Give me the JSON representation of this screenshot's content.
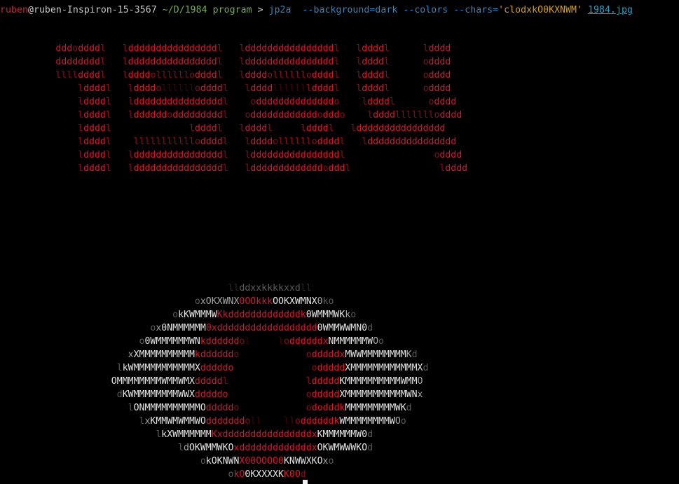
{
  "terminal": {
    "prompt": {
      "user": "ruben",
      "at": "@",
      "host": "ruben-Inspiron-15-3567",
      "path": "~/D/1984 program",
      "symbol": ">",
      "command": "jp2a",
      "options": "--background=dark --colors --chars=",
      "chars_arg": "'clodxkO0KXNWM'",
      "file": "1984.jpg"
    },
    "colors": {
      "background": "#000000",
      "user": "#d2213a",
      "path": "#6fb04c",
      "command": "#2b87c8",
      "string": "#d4a022",
      "file": "#2aa0c8",
      "art_red": "#e0132b",
      "art_white": "#e4e4e4"
    },
    "art_1984": [
      [
        [
          "          ",
          ""
        ],
        [
          "ddd",
          "r"
        ],
        [
          "o",
          "rd"
        ],
        [
          "dddd",
          "r"
        ],
        [
          "l",
          "rd"
        ],
        [
          "   ",
          ""
        ],
        [
          "l",
          "rd"
        ],
        [
          "dddddddddddddddd",
          "r"
        ],
        [
          "l",
          "rd"
        ],
        [
          "   ",
          ""
        ],
        [
          "l",
          "rd"
        ],
        [
          "dddddddddddddddd",
          "r"
        ],
        [
          "l",
          "rd"
        ],
        [
          "   ",
          ""
        ],
        [
          "l",
          "rd"
        ],
        [
          "dddd",
          "r"
        ],
        [
          "l",
          "rd"
        ],
        [
          "      ",
          ""
        ],
        [
          "l",
          "rd"
        ],
        [
          "dddd",
          "r"
        ]
      ],
      [
        [
          "          ",
          ""
        ],
        [
          "dddddddd",
          "r"
        ],
        [
          "l",
          "rd"
        ],
        [
          "   ",
          ""
        ],
        [
          "l",
          "rd"
        ],
        [
          "dddddddddddddddd",
          "r"
        ],
        [
          "l",
          "rd"
        ],
        [
          "   ",
          ""
        ],
        [
          "l",
          "rd"
        ],
        [
          "dddddddddddddddd",
          "r"
        ],
        [
          "l",
          "rd"
        ],
        [
          "   ",
          ""
        ],
        [
          "l",
          "rd"
        ],
        [
          "dddd",
          "r"
        ],
        [
          "l",
          "rd"
        ],
        [
          "      ",
          ""
        ],
        [
          "o",
          "rd"
        ],
        [
          "dddd",
          "r"
        ]
      ],
      [
        [
          "          ",
          ""
        ],
        [
          "llll",
          "rd"
        ],
        [
          "dddd",
          "r"
        ],
        [
          "l",
          "rd"
        ],
        [
          "   ",
          ""
        ],
        [
          "l",
          "rd"
        ],
        [
          "dddd",
          "r"
        ],
        [
          "ollllll",
          "rd"
        ],
        [
          "o",
          "rd"
        ],
        [
          "dddd",
          "r"
        ],
        [
          "l",
          "rd"
        ],
        [
          "   ",
          ""
        ],
        [
          "l",
          "rd"
        ],
        [
          "dddd",
          "r"
        ],
        [
          "ollllll",
          "rd"
        ],
        [
          "o",
          "rd"
        ],
        [
          "dddd",
          "r"
        ],
        [
          "l",
          "rd"
        ],
        [
          "   ",
          ""
        ],
        [
          "l",
          "rd"
        ],
        [
          "dddd",
          "r"
        ],
        [
          "l",
          "rd"
        ],
        [
          "      ",
          ""
        ],
        [
          "o",
          "rd"
        ],
        [
          "dddd",
          "r"
        ]
      ],
      [
        [
          "              ",
          ""
        ],
        [
          "l",
          "rd"
        ],
        [
          "dddd",
          "r"
        ],
        [
          "l",
          "rd"
        ],
        [
          "   ",
          ""
        ],
        [
          "l",
          "rd"
        ],
        [
          "dddd",
          "r"
        ],
        [
          "o",
          "rd"
        ],
        [
          "llllll",
          "rr"
        ],
        [
          "o",
          "rd"
        ],
        [
          "dddd",
          "r"
        ],
        [
          "l",
          "rd"
        ],
        [
          "   ",
          ""
        ],
        [
          "l",
          "rd"
        ],
        [
          "dddd",
          "r"
        ],
        [
          "llllll",
          "rr"
        ],
        [
          "l",
          "rd"
        ],
        [
          "dddd",
          "r"
        ],
        [
          "l",
          "rd"
        ],
        [
          "   ",
          ""
        ],
        [
          "l",
          "rd"
        ],
        [
          "dddd",
          "r"
        ],
        [
          "l",
          "rd"
        ],
        [
          "      ",
          ""
        ],
        [
          "o",
          "rd"
        ],
        [
          "dddd",
          "r"
        ]
      ],
      [
        [
          "              ",
          ""
        ],
        [
          "l",
          "rd"
        ],
        [
          "dddd",
          "r"
        ],
        [
          "l",
          "rd"
        ],
        [
          "   ",
          ""
        ],
        [
          "l",
          "rd"
        ],
        [
          "dddddddddddddddd",
          "r"
        ],
        [
          "l",
          "rd"
        ],
        [
          "    ",
          ""
        ],
        [
          "o",
          "rd"
        ],
        [
          "dddddddddddddd",
          "r"
        ],
        [
          "o",
          "rd"
        ],
        [
          "    ",
          ""
        ],
        [
          "l",
          "rd"
        ],
        [
          "dddd",
          "r"
        ],
        [
          "l",
          "rd"
        ],
        [
          "      ",
          ""
        ],
        [
          "o",
          "rd"
        ],
        [
          "dddd",
          "r"
        ]
      ],
      [
        [
          "              ",
          ""
        ],
        [
          "l",
          "rd"
        ],
        [
          "dddd",
          "r"
        ],
        [
          "l",
          "rd"
        ],
        [
          "   ",
          ""
        ],
        [
          "l",
          "rd"
        ],
        [
          "dddddd",
          "r"
        ],
        [
          "o",
          "rd"
        ],
        [
          "ddddddddd",
          "r"
        ],
        [
          "l",
          "rd"
        ],
        [
          "   ",
          ""
        ],
        [
          "o",
          "rd"
        ],
        [
          "dddddddddddd",
          "r"
        ],
        [
          "o",
          "rd"
        ],
        [
          "ddd",
          "r"
        ],
        [
          "o",
          "rd"
        ],
        [
          "    ",
          ""
        ],
        [
          "l",
          "rd"
        ],
        [
          "dddd",
          "r"
        ],
        [
          "lllllll",
          "rd"
        ],
        [
          "o",
          "rd"
        ],
        [
          "dddd",
          "r"
        ]
      ],
      [
        [
          "              ",
          ""
        ],
        [
          "l",
          "rd"
        ],
        [
          "dddd",
          "r"
        ],
        [
          "l",
          "rd"
        ],
        [
          "   ",
          ""
        ],
        [
          "           ",
          "rr"
        ],
        [
          "l",
          "rd"
        ],
        [
          "dddd",
          "r"
        ],
        [
          "l",
          "rd"
        ],
        [
          "   ",
          ""
        ],
        [
          "l",
          "rd"
        ],
        [
          "dddd",
          "r"
        ],
        [
          "l",
          "rd"
        ],
        [
          "     ",
          "rr"
        ],
        [
          "l",
          "rd"
        ],
        [
          "dddd",
          "r"
        ],
        [
          "l",
          "rd"
        ],
        [
          "   ",
          ""
        ],
        [
          "l",
          "rd"
        ],
        [
          "dddddddddddddddd",
          "r"
        ]
      ],
      [
        [
          "              ",
          ""
        ],
        [
          "l",
          "rd"
        ],
        [
          "dddd",
          "r"
        ],
        [
          "l",
          "rd"
        ],
        [
          "    ",
          ""
        ],
        [
          "lllllllllll",
          "rd"
        ],
        [
          "o",
          "rd"
        ],
        [
          "dddd",
          "r"
        ],
        [
          "l",
          "rd"
        ],
        [
          "   ",
          ""
        ],
        [
          "l",
          "rd"
        ],
        [
          "dddd",
          "r"
        ],
        [
          "ollllll",
          "rd"
        ],
        [
          "o",
          "rd"
        ],
        [
          "dddd",
          "r"
        ],
        [
          "l",
          "rd"
        ],
        [
          "   ",
          ""
        ],
        [
          "l",
          "rd"
        ],
        [
          "dddddddddddddddd",
          "r"
        ]
      ],
      [
        [
          "              ",
          ""
        ],
        [
          "l",
          "rd"
        ],
        [
          "dddd",
          "r"
        ],
        [
          "l",
          "rd"
        ],
        [
          "   ",
          ""
        ],
        [
          "l",
          "rd"
        ],
        [
          "dddddddddddddddd",
          "r"
        ],
        [
          "l",
          "rd"
        ],
        [
          "   ",
          ""
        ],
        [
          "l",
          "rd"
        ],
        [
          "dddddddddddddddd",
          "r"
        ],
        [
          "l",
          "rd"
        ],
        [
          "     ",
          ""
        ],
        [
          "           ",
          "rr"
        ],
        [
          "o",
          "rd"
        ],
        [
          "dddd",
          "r"
        ]
      ],
      [
        [
          "              ",
          ""
        ],
        [
          "l",
          "rd"
        ],
        [
          "dddd",
          "r"
        ],
        [
          "l",
          "rd"
        ],
        [
          "   ",
          ""
        ],
        [
          "l",
          "rd"
        ],
        [
          "dddddddddddddddd",
          "r"
        ],
        [
          "l",
          "rd"
        ],
        [
          "   ",
          ""
        ],
        [
          "l",
          "rd"
        ],
        [
          "ddddddddddddd",
          "r"
        ],
        [
          "o",
          "rd"
        ],
        [
          "ddd",
          "r"
        ],
        [
          "l",
          "rd"
        ],
        [
          "                ",
          ""
        ],
        [
          "l",
          "rd"
        ],
        [
          "dddd",
          "r"
        ]
      ]
    ],
    "art_eye": [
      [
        [
          "                                         ",
          ""
        ],
        [
          "ll",
          "gr"
        ],
        [
          "ddxxkkkkxxd",
          "gd"
        ],
        [
          "ll",
          "gr"
        ]
      ],
      [
        [
          "                                   ",
          ""
        ],
        [
          "o",
          "gd"
        ],
        [
          "xOKXWNX",
          "g"
        ],
        [
          "0OO",
          "r"
        ],
        [
          "kkk",
          "r"
        ],
        [
          "OOKXWMNX",
          "w"
        ],
        [
          "0",
          "g"
        ],
        [
          "k",
          "gd"
        ],
        [
          "o",
          "gd"
        ]
      ],
      [
        [
          "                               ",
          ""
        ],
        [
          "o",
          "gd"
        ],
        [
          "kKWMMMW",
          "w"
        ],
        [
          "Kk",
          "r"
        ],
        [
          "dddddddddddddk",
          "r"
        ],
        [
          "0WMMMWK",
          "w"
        ],
        [
          "k",
          "g"
        ],
        [
          "o",
          "gd"
        ]
      ],
      [
        [
          "                           ",
          ""
        ],
        [
          "o",
          "gd"
        ],
        [
          "x",
          "g"
        ],
        [
          "0NMMMMMM",
          "w"
        ],
        [
          "0",
          "r"
        ],
        [
          "xdddddddddddddddddd",
          "r"
        ],
        [
          "0",
          "w"
        ],
        [
          "WMMWWMN0",
          "w"
        ],
        [
          "d",
          "gd"
        ]
      ],
      [
        [
          "                         ",
          ""
        ],
        [
          "o",
          "gd"
        ],
        [
          "0WMMMMMMWN",
          "w"
        ],
        [
          "kdddddd",
          "r"
        ],
        [
          "o",
          "rd"
        ],
        [
          "l",
          "rr"
        ],
        [
          "     ",
          ""
        ],
        [
          "l",
          "rr"
        ],
        [
          "o",
          "rd"
        ],
        [
          "dddddd",
          "r"
        ],
        [
          "x",
          "r"
        ],
        [
          "NMMMMMMW",
          "w"
        ],
        [
          "O",
          "g"
        ],
        [
          "o",
          "gd"
        ]
      ],
      [
        [
          "                       ",
          ""
        ],
        [
          "x",
          "g"
        ],
        [
          "XMMMMMMMMMM",
          "w"
        ],
        [
          "kdddddd",
          "r"
        ],
        [
          "o",
          "rd"
        ],
        [
          "            ",
          ""
        ],
        [
          "o",
          "rd"
        ],
        [
          "dddddx",
          "r"
        ],
        [
          "MWWMMMMMMMM",
          "w"
        ],
        [
          "K",
          "g"
        ],
        [
          "d",
          "gd"
        ]
      ],
      [
        [
          "                     ",
          ""
        ],
        [
          "l",
          "gd"
        ],
        [
          "kWMMMMMMMMMMMX",
          "w"
        ],
        [
          "dddddo",
          "r"
        ],
        [
          "              ",
          ""
        ],
        [
          "o",
          "rd"
        ],
        [
          "ddddd",
          "r"
        ],
        [
          "XMMMMMMMMMMMMX",
          "w"
        ],
        [
          "d",
          "gd"
        ]
      ],
      [
        [
          "                    ",
          ""
        ],
        [
          "OMMMMMMMMWMMWMX",
          "w"
        ],
        [
          "ddddd",
          "r"
        ],
        [
          "l",
          "rd"
        ],
        [
          "              ",
          ""
        ],
        [
          "l",
          "rd"
        ],
        [
          "ddddd",
          "r"
        ],
        [
          "KMMMMMMMMMMWMM",
          "w"
        ],
        [
          "O",
          "g"
        ]
      ],
      [
        [
          "                     ",
          ""
        ],
        [
          "d",
          "gd"
        ],
        [
          "KWMMMMMMMMWWX",
          "w"
        ],
        [
          "dddddo",
          "r"
        ],
        [
          "              ",
          ""
        ],
        [
          "o",
          "rd"
        ],
        [
          "ddddd",
          "r"
        ],
        [
          "XMMMMMMMMMMMWN",
          "w"
        ],
        [
          "x",
          "g"
        ]
      ],
      [
        [
          "                       ",
          ""
        ],
        [
          "l",
          "gd"
        ],
        [
          "ONMMMMMMMMMMO",
          "w"
        ],
        [
          "ddddd",
          "r"
        ],
        [
          "o",
          "rd"
        ],
        [
          "            ",
          ""
        ],
        [
          "o",
          "rd"
        ],
        [
          "dodddk",
          "r"
        ],
        [
          "MMMMMMMMMWK",
          "w"
        ],
        [
          "d",
          "gd"
        ]
      ],
      [
        [
          "                         ",
          ""
        ],
        [
          "l",
          "gd"
        ],
        [
          "x",
          "g"
        ],
        [
          "KMMWMWMMWO",
          "w"
        ],
        [
          "ddddddd",
          "r"
        ],
        [
          "o",
          "rd"
        ],
        [
          "ll",
          "rr"
        ],
        [
          "    ",
          ""
        ],
        [
          "ll",
          "rr"
        ],
        [
          "o",
          "rd"
        ],
        [
          "ddddddk",
          "r"
        ],
        [
          "WMMMMMMMMW",
          "w"
        ],
        [
          "O",
          "g"
        ],
        [
          "o",
          "gd"
        ]
      ],
      [
        [
          "                            ",
          ""
        ],
        [
          "l",
          "gd"
        ],
        [
          "kXWMMMMMM",
          "w"
        ],
        [
          "Kx",
          "r"
        ],
        [
          "ddddddddddddddddx",
          "r"
        ],
        [
          "KMMMMMMW0",
          "w"
        ],
        [
          "d",
          "gd"
        ]
      ],
      [
        [
          "                                ",
          ""
        ],
        [
          "l",
          "gd"
        ],
        [
          "d",
          "g"
        ],
        [
          "OKWMMWKO",
          "w"
        ],
        [
          "xdddddddddddddx",
          "r"
        ],
        [
          "OKWMWWWKO",
          "w"
        ],
        [
          "d",
          "gd"
        ]
      ],
      [
        [
          "                                    ",
          ""
        ],
        [
          "o",
          "gd"
        ],
        [
          "kOKNWN",
          "w"
        ],
        [
          "X00OOOO0",
          "r"
        ],
        [
          "KNWWXKO",
          "w"
        ],
        [
          "x",
          "g"
        ],
        [
          "o",
          "gd"
        ]
      ],
      [
        [
          "                                         ",
          ""
        ],
        [
          "o",
          "gd"
        ],
        [
          "kO",
          "r"
        ],
        [
          "0KXXXXK",
          "w"
        ],
        [
          "K0",
          "r"
        ],
        [
          "O",
          "r"
        ],
        [
          "d",
          "rd"
        ]
      ]
    ]
  }
}
